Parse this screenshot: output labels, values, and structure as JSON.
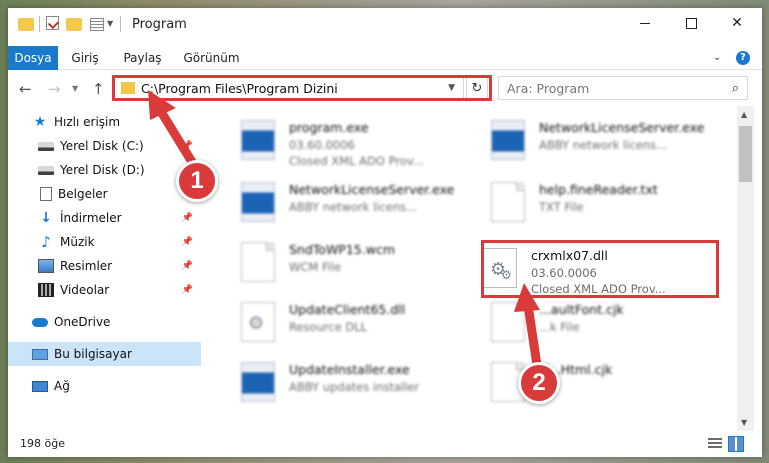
{
  "window": {
    "title": "Program",
    "controls": {
      "minimize": "",
      "maximize": "",
      "close": "✕"
    }
  },
  "ribbon": {
    "tabs": [
      "Dosya",
      "Giriş",
      "Paylaş",
      "Görünüm"
    ],
    "help": "?"
  },
  "address": {
    "path": "C:\\Program Files\\Program Dizini",
    "search_placeholder": "Ara: Program"
  },
  "sidebar": {
    "items": [
      {
        "label": "Hızlı erişim",
        "icon": "star-icon"
      },
      {
        "label": "Yerel Disk (C:)",
        "icon": "disk-icon",
        "pinned": true
      },
      {
        "label": "Yerel Disk (D:)",
        "icon": "disk-icon",
        "pinned": true
      },
      {
        "label": "Belgeler",
        "icon": "documents-icon",
        "pinned": true
      },
      {
        "label": "İndirmeler",
        "icon": "download-icon",
        "pinned": true
      },
      {
        "label": "Müzik",
        "icon": "music-icon",
        "pinned": true
      },
      {
        "label": "Resimler",
        "icon": "pictures-icon",
        "pinned": true
      },
      {
        "label": "Videolar",
        "icon": "videos-icon",
        "pinned": true
      },
      {
        "label": "OneDrive",
        "icon": "onedrive-icon"
      },
      {
        "label": "Bu bilgisayar",
        "icon": "pc-icon",
        "selected": true
      },
      {
        "label": "Ağ",
        "icon": "network-icon"
      }
    ]
  },
  "files": [
    {
      "name": "program.exe",
      "line2": "03.60.0006",
      "line3": "Closed XML ADO Prov...",
      "icon": "app-icon"
    },
    {
      "name": "NetworkLicenseServer.exe",
      "line2": "ABBY network licens...",
      "line3": "",
      "icon": "app-icon"
    },
    {
      "name": "NetworkLicenseServer.exe",
      "line2": "ABBY network licens...",
      "line3": "",
      "icon": "app-icon"
    },
    {
      "name": "help.fineReader.txt",
      "line2": "TXT File",
      "line3": "",
      "icon": "document-icon"
    },
    {
      "name": "SndToWP15.wcm",
      "line2": "WCM File",
      "line3": "",
      "icon": "document-icon"
    },
    {
      "name": "crxmlx07.dll",
      "line2": "03.60.0006",
      "line3": "Closed XML ADO Prov...",
      "icon": "gear-file-icon",
      "highlighted": true
    },
    {
      "name": "UpdateClient65.dll",
      "line2": "Resource DLL",
      "line3": "",
      "icon": "gear-file-icon"
    },
    {
      "name": "...aultFont.cjk",
      "line2": "...k File",
      "line3": "",
      "icon": "document-icon"
    },
    {
      "name": "UpdateInstaller.exe",
      "line2": "ABBY updates installer",
      "line3": "",
      "icon": "app-icon"
    },
    {
      "name": "Fi...Html.cjk",
      "line2": "",
      "line3": "",
      "icon": "document-icon"
    }
  ],
  "status": {
    "item_count": "198 öğe"
  },
  "callouts": {
    "step1": "1",
    "step2": "2"
  },
  "colors": {
    "accent": "#1979ca",
    "highlight": "#d93a3a",
    "selected": "#cce4f7"
  }
}
